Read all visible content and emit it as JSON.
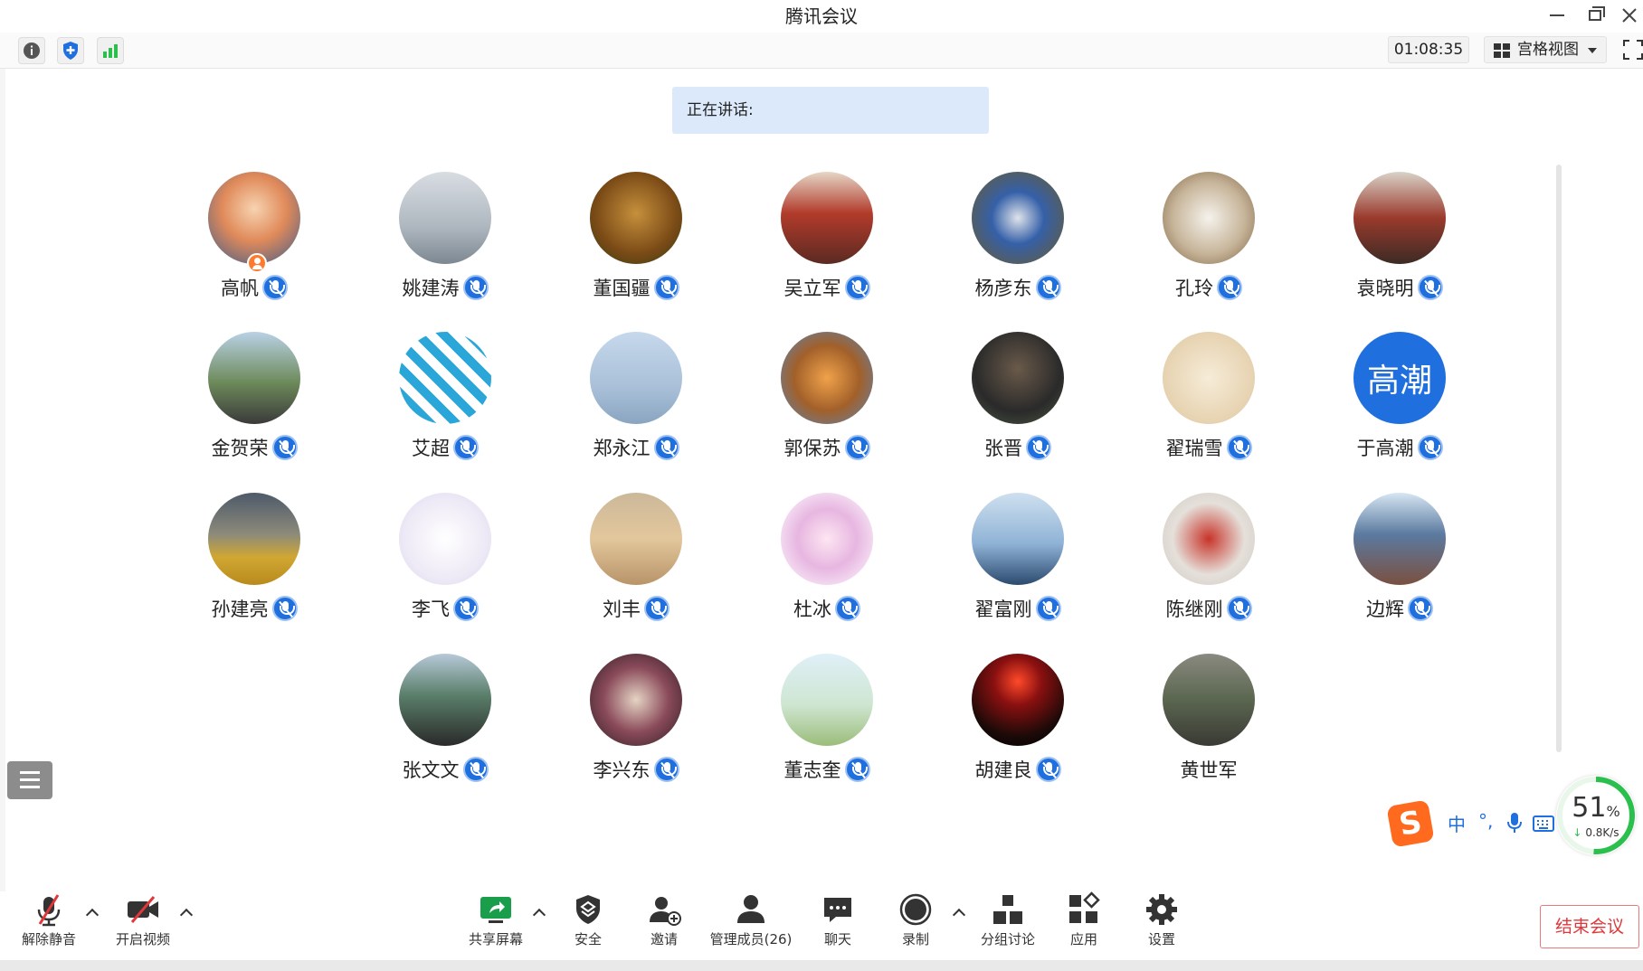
{
  "window": {
    "title": "腾讯会议"
  },
  "infobar": {
    "timer": "01:08:35",
    "view_mode": "宫格视图"
  },
  "speaking": {
    "label": "正在讲话:"
  },
  "participants": [
    {
      "name": "高帆",
      "host": true,
      "mic": true
    },
    {
      "name": "姚建涛",
      "mic": true
    },
    {
      "name": "董国疆",
      "mic": true
    },
    {
      "name": "吴立军",
      "mic": true
    },
    {
      "name": "杨彦东",
      "mic": true
    },
    {
      "name": "孔玲",
      "mic": true
    },
    {
      "name": "袁晓明",
      "mic": true
    },
    {
      "name": "金贺荣",
      "mic": true
    },
    {
      "name": "艾超",
      "mic": true
    },
    {
      "name": "郑永江",
      "mic": true
    },
    {
      "name": "郭保苏",
      "mic": true
    },
    {
      "name": "张晋",
      "mic": true
    },
    {
      "name": "翟瑞雪",
      "mic": true
    },
    {
      "name": "于高潮",
      "mic": true,
      "avatar_text": "高潮"
    },
    {
      "name": "孙建亮",
      "mic": true
    },
    {
      "name": "李飞",
      "mic": true
    },
    {
      "name": "刘丰",
      "mic": true
    },
    {
      "name": "杜冰",
      "mic": true
    },
    {
      "name": "翟富刚",
      "mic": true
    },
    {
      "name": "陈继刚",
      "mic": true
    },
    {
      "name": "边辉",
      "mic": true
    },
    {
      "name": "张文文",
      "mic": true
    },
    {
      "name": "李兴东",
      "mic": true
    },
    {
      "name": "董志奎",
      "mic": true
    },
    {
      "name": "胡建良",
      "mic": true
    },
    {
      "name": "黄世军",
      "mic": false
    }
  ],
  "ime": {
    "logo": "S",
    "mode": "中",
    "punct": "°,"
  },
  "network": {
    "percent": "51",
    "percent_unit": "%",
    "speed": "0.8K/s",
    "arrow": "↓"
  },
  "toolbar": {
    "unmute": "解除静音",
    "start_video": "开启视频",
    "share_screen": "共享屏幕",
    "security": "安全",
    "invite": "邀请",
    "manage_members": "管理成员(26)",
    "chat": "聊天",
    "record": "录制",
    "breakout": "分组讨论",
    "apps": "应用",
    "settings": "设置",
    "end_meeting": "结束会议"
  },
  "colors": {
    "accent": "#1f6fde",
    "end_meeting": "#e0373a",
    "speaking_bg": "#dbe9fb",
    "network_ok": "#2bbf4d"
  }
}
